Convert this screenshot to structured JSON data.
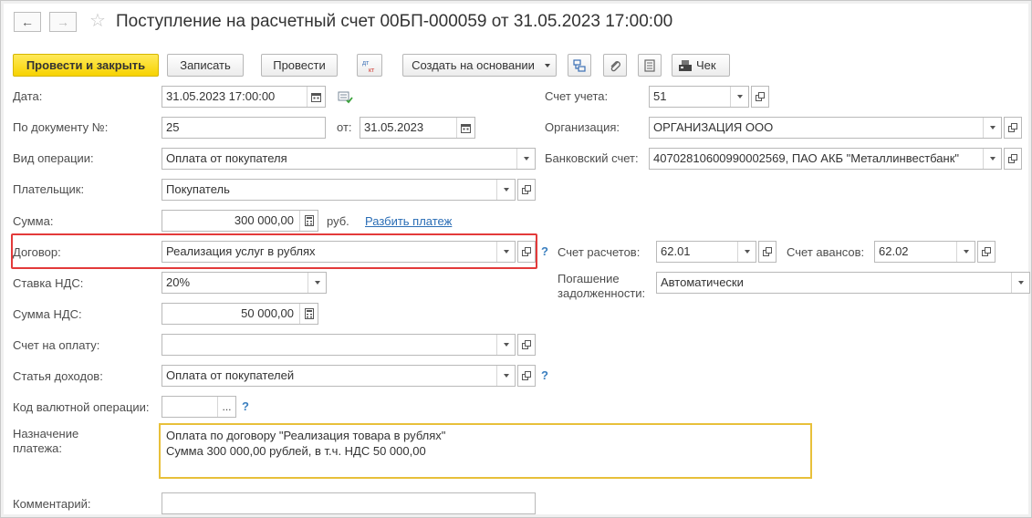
{
  "header": {
    "back_label": "←",
    "forward_label": "→",
    "favorite_label": "☆",
    "title": "Поступление на расчетный счет 00БП-000059 от 31.05.2023 17:00:00"
  },
  "toolbar": {
    "post_close_label": "Провести и закрыть",
    "save_label": "Записать",
    "post_label": "Провести",
    "dtkt_top": "дт",
    "dtkt_bottom": "кт",
    "create_based_label": "Создать на основании",
    "receipt_label": "Чек"
  },
  "form": {
    "date_label": "Дата:",
    "date_value": "31.05.2023 17:00:00",
    "doc_no_label": "По документу №:",
    "doc_no_value": "25",
    "from_label": "от:",
    "from_value": "31.05.2023",
    "operation_label": "Вид операции:",
    "operation_value": "Оплата от покупателя",
    "payer_label": "Плательщик:",
    "payer_value": "Покупатель",
    "sum_label": "Сумма:",
    "sum_value": "300 000,00",
    "currency_label": "руб.",
    "split_link": "Разбить платеж",
    "contract_label": "Договор:",
    "contract_value": "Реализация услуг в рублях",
    "vat_rate_label": "Ставка НДС:",
    "vat_rate_value": "20%",
    "vat_sum_label": "Сумма НДС:",
    "vat_sum_value": "50 000,00",
    "invoice_label": "Счет на оплату:",
    "invoice_value": "",
    "income_label": "Статья доходов:",
    "income_value": "Оплата от покупателей",
    "currency_op_label": "Код валютной операции:",
    "currency_op_value": "",
    "purpose_label_1": "Назначение",
    "purpose_label_2": "платежа:",
    "purpose_line_1": "Оплата по договору \"Реализация товара в рублях\"",
    "purpose_line_2": "Сумма 300 000,00 рублей, в т.ч. НДС 50 000,00",
    "comment_label": "Комментарий:",
    "comment_value": "",
    "account_label": "Счет учета:",
    "account_value": "51",
    "org_label": "Организация:",
    "org_value": "ОРГАНИЗАЦИЯ ООО",
    "bank_label": "Банковский счет:",
    "bank_value": "40702810600990002569, ПАО АКБ \"Металлинвестбанк\"",
    "settle_label": "Счет расчетов:",
    "settle_value": "62.01",
    "advance_label": "Счет авансов:",
    "advance_value": "62.02",
    "repay_label_1": "Погашение",
    "repay_label_2": "задолженности:",
    "repay_value": "Автоматически",
    "help_mark": "?",
    "ellipsis": "..."
  }
}
